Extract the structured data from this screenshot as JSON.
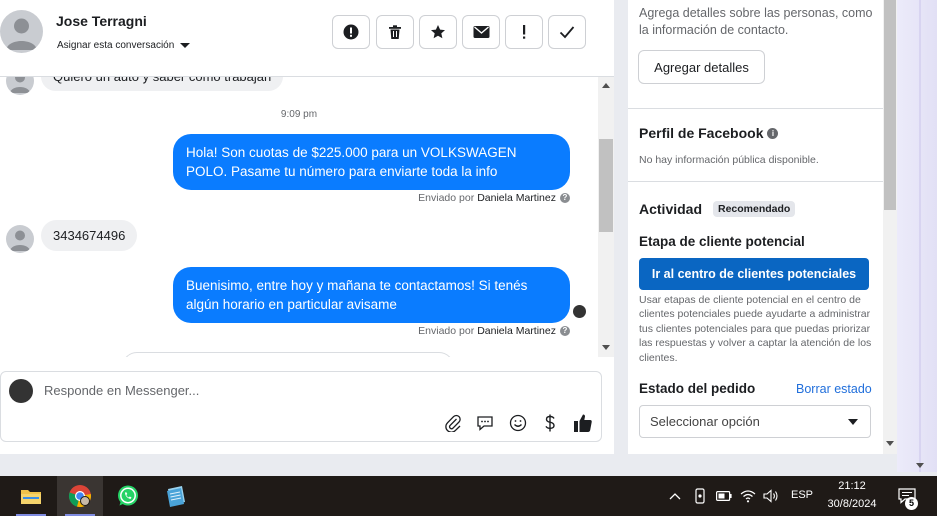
{
  "header": {
    "contact_name": "Jose Terragni",
    "assign_label": "Asignar esta conversación"
  },
  "conversation": {
    "partial_message": "Quiero un auto y saber como trabajan",
    "timestamp": "9:09 pm",
    "messages": [
      {
        "direction": "out",
        "text": "Hola! Son cuotas de $225.000 para un VOLKSWAGEN POLO. Pasame tu número para enviarte toda la info",
        "sent_by_label": "Enviado por",
        "agent": "Daniela Martinez"
      },
      {
        "direction": "in",
        "text": "3434674496"
      },
      {
        "direction": "out",
        "text": "Buenisimo, entre hoy y mañana te contactamos! Si tenés algún horario en particular avisame",
        "sent_by_label": "Enviado por",
        "agent": "Daniela Martinez"
      }
    ]
  },
  "composer": {
    "placeholder": "Responde en Messenger..."
  },
  "right_panel": {
    "details_text": "Agrega detalles sobre las personas, como la información de contacto.",
    "add_details_label": "Agregar detalles",
    "facebook_profile_title": "Perfil de Facebook",
    "facebook_profile_text": "No hay información pública disponible.",
    "activity_title": "Actividad",
    "recommended_badge": "Recomendado",
    "lead_stage_title": "Etapa de cliente potencial",
    "lead_center_button": "Ir al centro de clientes potenciales",
    "lead_stage_text": "Usar etapas de cliente potencial en el centro de clientes potenciales puede ayudarte a administrar tus clientes potenciales para que puedas priorizar las respuestas y volver a captar la atención de los clientes.",
    "order_status_title": "Estado del pedido",
    "clear_status_link": "Borrar estado",
    "order_select_placeholder": "Seleccionar opción"
  },
  "taskbar": {
    "language": "ESP",
    "time": "21:12",
    "date": "30/8/2024",
    "notification_count": "5"
  },
  "colors": {
    "outgoing_bubble": "#0a7cff",
    "lead_button": "#0a66c2",
    "link": "#216fdb"
  }
}
